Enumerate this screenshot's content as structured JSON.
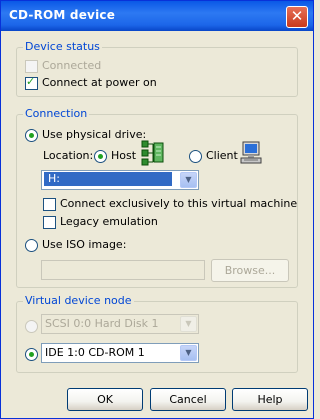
{
  "window": {
    "title": "CD-ROM device"
  },
  "device_status": {
    "legend": "Device status",
    "connected": {
      "label": "Connected",
      "checked": false,
      "enabled": false
    },
    "connect_at_power_on": {
      "label": "Connect at power on",
      "checked": true
    }
  },
  "connection": {
    "legend": "Connection",
    "use_physical_drive": {
      "label": "Use physical drive:",
      "selected": true
    },
    "location_label": "Location:",
    "host": {
      "label": "Host",
      "selected": true
    },
    "client": {
      "label": "Client",
      "selected": false
    },
    "drive_select": {
      "value": "H:"
    },
    "connect_exclusively": {
      "label": "Connect exclusively to this virtual machine",
      "checked": false
    },
    "legacy_emulation": {
      "label": "Legacy emulation",
      "checked": false
    },
    "use_iso_image": {
      "label": "Use ISO image:",
      "selected": false
    },
    "iso_path": {
      "value": ""
    },
    "browse_label": "Browse..."
  },
  "virtual_device_node": {
    "legend": "Virtual device node",
    "scsi_select": {
      "value": "SCSI 0:0   Hard Disk 1",
      "enabled": false
    },
    "ide_select": {
      "value": "IDE 1:0   CD-ROM 1",
      "selected": true
    }
  },
  "footer": {
    "ok": "OK",
    "cancel": "Cancel",
    "help": "Help"
  },
  "icons": [
    "close-icon",
    "host-network-icon",
    "client-computer-icon",
    "dropdown-arrow-icon"
  ]
}
